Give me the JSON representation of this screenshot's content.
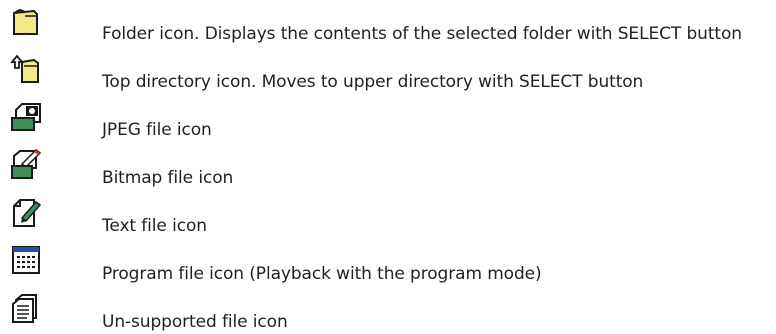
{
  "legend": {
    "items": [
      {
        "icon": "folder-icon",
        "text": "Folder icon. Displays the contents of the selected folder with SELECT button"
      },
      {
        "icon": "top-directory-icon",
        "text": "Top directory icon. Moves to upper directory with SELECT button"
      },
      {
        "icon": "jpeg-file-icon",
        "text": "JPEG file icon"
      },
      {
        "icon": "bitmap-file-icon",
        "text": "Bitmap file icon"
      },
      {
        "icon": "text-file-icon",
        "text": "Text file icon"
      },
      {
        "icon": "program-file-icon",
        "text": "Program file icon (Playback with the program mode)"
      },
      {
        "icon": "unsupported-file-icon",
        "text": "Un-supported file icon"
      }
    ]
  },
  "colors": {
    "folder": "#f2e98a",
    "outline": "#1a1a1a",
    "photo_green": "#3f8f5a",
    "program_blue": "#2b4fa8",
    "text": "#231f20"
  }
}
